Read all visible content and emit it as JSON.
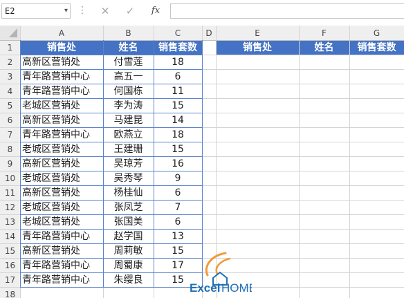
{
  "formula_bar": {
    "name_box": "E2",
    "name_box_arrow": "▾",
    "separator": "⋮",
    "cancel_symbol": "✕",
    "enter_symbol": "✓",
    "fx_label": "fx",
    "formula_value": ""
  },
  "sheet": {
    "columns": [
      "A",
      "B",
      "C",
      "D",
      "E",
      "F",
      "G"
    ],
    "row_numbers": [
      "1",
      "2",
      "3",
      "4",
      "5",
      "6",
      "7",
      "8",
      "9",
      "10",
      "11",
      "12",
      "13",
      "14",
      "15",
      "16",
      "17",
      "18"
    ],
    "source_headers": [
      "销售处",
      "姓名",
      "销售套数"
    ],
    "target_headers": [
      "销售处",
      "姓名",
      "销售套数"
    ],
    "rows": [
      [
        "高新区营销处",
        "付雪莲",
        "18"
      ],
      [
        "青年路营销中心",
        "高五一",
        "6"
      ],
      [
        "青年路营销中心",
        "何国栋",
        "11"
      ],
      [
        "老城区营销处",
        "李为涛",
        "15"
      ],
      [
        "高新区营销处",
        "马建昆",
        "14"
      ],
      [
        "青年路营销中心",
        "欧燕立",
        "18"
      ],
      [
        "老城区营销处",
        "王建珊",
        "15"
      ],
      [
        "高新区营销处",
        "吴琼芳",
        "16"
      ],
      [
        "老城区营销处",
        "吴秀琴",
        "9"
      ],
      [
        "高新区营销处",
        "杨桂仙",
        "6"
      ],
      [
        "老城区营销处",
        "张凤芝",
        "7"
      ],
      [
        "老城区营销处",
        "张国美",
        "6"
      ],
      [
        "青年路营销中心",
        "赵学国",
        "13"
      ],
      [
        "高新区营销处",
        "周莉敏",
        "15"
      ],
      [
        "青年路营销中心",
        "周蜀康",
        "17"
      ],
      [
        "青年路营销中心",
        "朱缨良",
        "15"
      ]
    ]
  },
  "logo": {
    "part1": "Excel",
    "part2": "HOME"
  },
  "colors": {
    "header_fill": "#4472c4",
    "header_text": "#ffffff",
    "gridline": "#d4d4d4",
    "table_border": "#5b83c9",
    "logo_text": "#1f6fb5",
    "logo_swirl": "#f29a3a"
  }
}
